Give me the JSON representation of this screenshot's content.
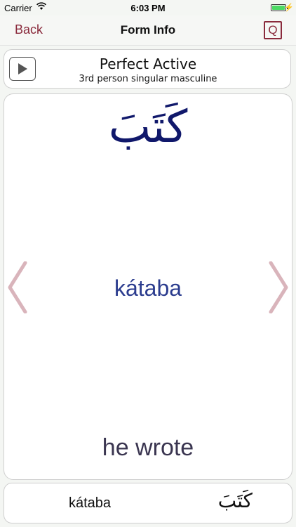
{
  "status_bar": {
    "carrier": "Carrier",
    "time": "6:03 PM",
    "battery_color": "#4cd964"
  },
  "nav": {
    "back_label": "Back",
    "title": "Form Info",
    "quiz_label": "Q",
    "accent_color": "#8a2a3c"
  },
  "header": {
    "play_icon": "play-icon",
    "title": "Perfect Active",
    "subtitle": "3rd person singular masculine"
  },
  "card": {
    "arabic": "كَتَبَ",
    "transliteration": "kátaba",
    "translation": "he wrote",
    "arabic_color": "#10186b",
    "transliteration_color": "#2b3c8e",
    "arrow_color": "#d9b4bb",
    "prev_icon": "chevron-left-icon",
    "next_icon": "chevron-right-icon"
  },
  "footer": {
    "transliteration": "kátaba",
    "arabic": "كَتَبَ"
  }
}
